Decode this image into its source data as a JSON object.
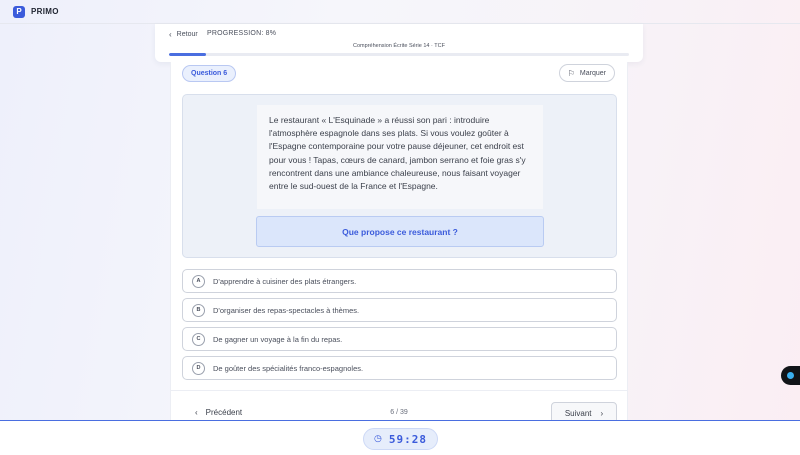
{
  "app": {
    "logo_letter": "P",
    "brand": "PRIMO"
  },
  "header": {
    "back_label": "Retour",
    "progress_label": "PROGRESSION: 8%",
    "progress_fraction": 0.08,
    "test_title": "Compréhension Écrite Série 14 · TCF"
  },
  "question": {
    "badge": "Question 6",
    "mark_label": "Marquer",
    "passage": "Le restaurant « L'Esquinade » a réussi son pari : introduire l'atmosphère espagnole dans ses plats. Si vous voulez goûter à l'Espagne contemporaine pour votre pause déjeuner, cet endroit est pour vous ! Tapas, cœurs de canard, jambon serrano et foie gras s'y rencontrent dans une ambiance chaleureuse, nous faisant voyager entre le sud-ouest de la France et l'Espagne.",
    "prompt": "Que propose ce restaurant ?"
  },
  "options": [
    {
      "letter": "A",
      "text": "D'apprendre à cuisiner des plats étrangers."
    },
    {
      "letter": "B",
      "text": "D'organiser des repas-spectacles à thèmes."
    },
    {
      "letter": "C",
      "text": "De gagner un voyage à la fin du repas."
    },
    {
      "letter": "D",
      "text": "De goûter des spécialités franco-espagnoles."
    }
  ],
  "footer": {
    "prev_label": "Précédent",
    "counter": "6 / 39",
    "next_label": "Suivant"
  },
  "timer": {
    "value": "59:28"
  },
  "icons": {
    "back": "chevron-left-icon",
    "flag": "flag-icon",
    "next": "chevron-right-icon",
    "clock": "clock-icon"
  },
  "colors": {
    "accent": "#3b5bdb",
    "progress": "#4a6ee0",
    "side_dot": "#3ab0f0"
  }
}
